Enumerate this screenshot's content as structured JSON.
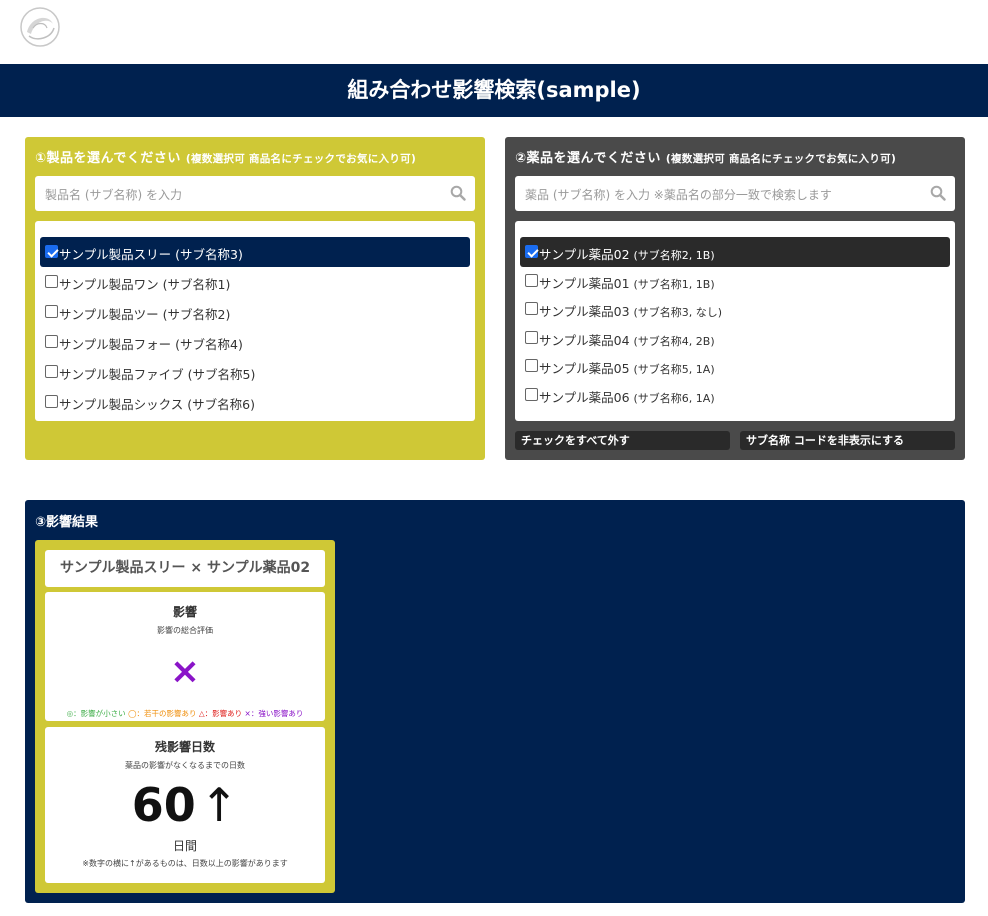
{
  "header": {
    "logo_icon": "swirl-logo-icon",
    "title": "組み合わせ影響検索(sample)"
  },
  "colors": {
    "navy": "#00214f",
    "olive": "#cfc836",
    "gray": "#4a4a4a",
    "purple": "#8a14c8"
  },
  "products": {
    "title": "①製品を選んでください",
    "subtitle": "(複数選択可 商品名にチェックでお気に入り可)",
    "search_placeholder": "製品名 (サブ名称) を入力",
    "items": [
      {
        "name": "サンプル製品スリー",
        "sub": "(サブ名称3)",
        "checked": true
      },
      {
        "name": "サンプル製品ワン",
        "sub": "(サブ名称1)",
        "checked": false
      },
      {
        "name": "サンプル製品ツー",
        "sub": "(サブ名称2)",
        "checked": false
      },
      {
        "name": "サンプル製品フォー",
        "sub": "(サブ名称4)",
        "checked": false
      },
      {
        "name": "サンプル製品ファイブ",
        "sub": "(サブ名称5)",
        "checked": false
      },
      {
        "name": "サンプル製品シックス",
        "sub": "(サブ名称6)",
        "checked": false
      }
    ]
  },
  "drugs": {
    "title": "②薬品を選んでください",
    "subtitle": "(複数選択可 商品名にチェックでお気に入り可)",
    "search_placeholder": "薬品 (サブ名称) を入力 ※薬品名の部分一致で検索します",
    "items": [
      {
        "name": "サンプル薬品02",
        "sub": "(サブ名称2, 1B)",
        "checked": true
      },
      {
        "name": "サンプル薬品01",
        "sub": "(サブ名称1, 1B)",
        "checked": false
      },
      {
        "name": "サンプル薬品03",
        "sub": "(サブ名称3, なし)",
        "checked": false
      },
      {
        "name": "サンプル薬品04",
        "sub": "(サブ名称4, 2B)",
        "checked": false
      },
      {
        "name": "サンプル薬品05",
        "sub": "(サブ名称5, 1A)",
        "checked": false
      },
      {
        "name": "サンプル薬品06",
        "sub": "(サブ名称6, 1A)",
        "checked": false
      }
    ],
    "uncheck_all_label": "チェックをすべて外す",
    "hide_sub_label": "サブ名称 コードを非表示にする"
  },
  "results": {
    "title": "③影響結果",
    "card": {
      "heading": "サンプル製品スリー × サンプル薬品02",
      "impact": {
        "title": "影響",
        "desc": "影響の総合評価",
        "mark": "×",
        "legend": [
          "◎：影響が小さい",
          "◯：若干の影響あり",
          "△：影響あり",
          "×：強い影響あり"
        ]
      },
      "days": {
        "title": "残影響日数",
        "desc": "薬品の影響がなくなるまでの日数",
        "value": "60",
        "arrow": "↑",
        "unit": "日間",
        "note": "※数字の横に↑があるものは、日数以上の影響があります"
      }
    }
  }
}
